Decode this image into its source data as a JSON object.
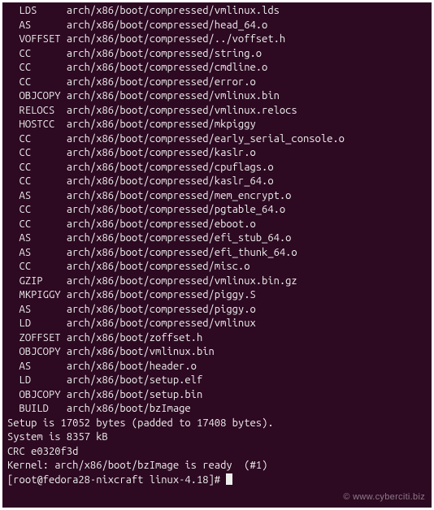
{
  "build_lines": [
    {
      "cmd": "LDS",
      "path": "arch/x86/boot/compressed/vmlinux.lds"
    },
    {
      "cmd": "AS",
      "path": "arch/x86/boot/compressed/head_64.o"
    },
    {
      "cmd": "VOFFSET",
      "path": "arch/x86/boot/compressed/../voffset.h"
    },
    {
      "cmd": "CC",
      "path": "arch/x86/boot/compressed/string.o"
    },
    {
      "cmd": "CC",
      "path": "arch/x86/boot/compressed/cmdline.o"
    },
    {
      "cmd": "CC",
      "path": "arch/x86/boot/compressed/error.o"
    },
    {
      "cmd": "OBJCOPY",
      "path": "arch/x86/boot/compressed/vmlinux.bin"
    },
    {
      "cmd": "RELOCS",
      "path": "arch/x86/boot/compressed/vmlinux.relocs"
    },
    {
      "cmd": "HOSTCC",
      "path": "arch/x86/boot/compressed/mkpiggy"
    },
    {
      "cmd": "CC",
      "path": "arch/x86/boot/compressed/early_serial_console.o"
    },
    {
      "cmd": "CC",
      "path": "arch/x86/boot/compressed/kaslr.o"
    },
    {
      "cmd": "CC",
      "path": "arch/x86/boot/compressed/cpuflags.o"
    },
    {
      "cmd": "CC",
      "path": "arch/x86/boot/compressed/kaslr_64.o"
    },
    {
      "cmd": "AS",
      "path": "arch/x86/boot/compressed/mem_encrypt.o"
    },
    {
      "cmd": "CC",
      "path": "arch/x86/boot/compressed/pgtable_64.o"
    },
    {
      "cmd": "CC",
      "path": "arch/x86/boot/compressed/eboot.o"
    },
    {
      "cmd": "AS",
      "path": "arch/x86/boot/compressed/efi_stub_64.o"
    },
    {
      "cmd": "AS",
      "path": "arch/x86/boot/compressed/efi_thunk_64.o"
    },
    {
      "cmd": "CC",
      "path": "arch/x86/boot/compressed/misc.o"
    },
    {
      "cmd": "GZIP",
      "path": "arch/x86/boot/compressed/vmlinux.bin.gz"
    },
    {
      "cmd": "MKPIGGY",
      "path": "arch/x86/boot/compressed/piggy.S"
    },
    {
      "cmd": "AS",
      "path": "arch/x86/boot/compressed/piggy.o"
    },
    {
      "cmd": "LD",
      "path": "arch/x86/boot/compressed/vmlinux"
    },
    {
      "cmd": "ZOFFSET",
      "path": "arch/x86/boot/zoffset.h"
    },
    {
      "cmd": "OBJCOPY",
      "path": "arch/x86/boot/vmlinux.bin"
    },
    {
      "cmd": "AS",
      "path": "arch/x86/boot/header.o"
    },
    {
      "cmd": "LD",
      "path": "arch/x86/boot/setup.elf"
    },
    {
      "cmd": "OBJCOPY",
      "path": "arch/x86/boot/setup.bin"
    },
    {
      "cmd": "BUILD",
      "path": "arch/x86/boot/bzImage"
    }
  ],
  "status_lines": [
    "Setup is 17052 bytes (padded to 17408 bytes).",
    "System is 8357 kB",
    "CRC e0320f3d",
    "Kernel: arch/x86/boot/bzImage is ready  (#1)"
  ],
  "prompt": "[root@fedora28-nixcraft linux-4.18]# ",
  "watermark": "© www.cyberciti.biz"
}
